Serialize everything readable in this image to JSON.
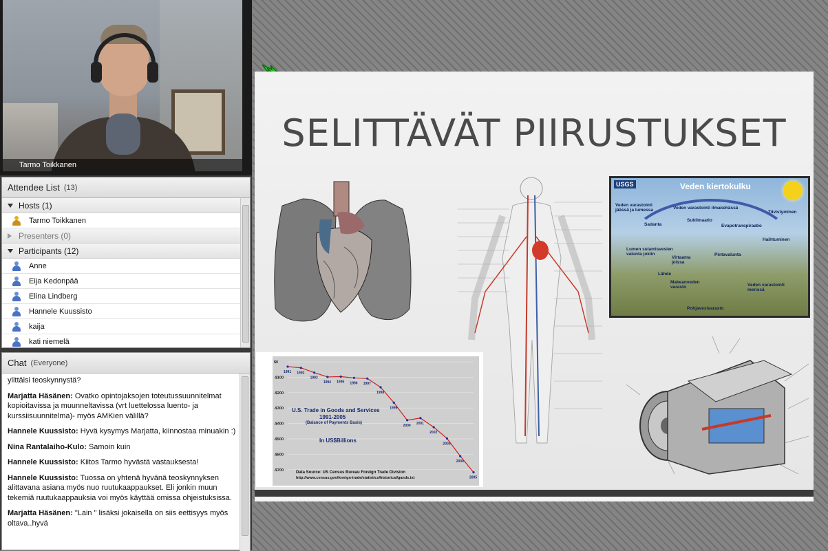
{
  "video": {
    "presenter_name": "Tarmo Toikkanen"
  },
  "attendee_list": {
    "title": "Attendee List",
    "count": "(13)",
    "groups": {
      "hosts": {
        "label": "Hosts (1)",
        "members": [
          "Tarmo Toikkanen"
        ]
      },
      "presenters": {
        "label": "Presenters (0)"
      },
      "participants": {
        "label": "Participants (12)",
        "members": [
          "Anne",
          "Eija Kedonpää",
          "Elina Lindberg",
          "Hannele Kuussisto",
          "kaija",
          "kati niemelä"
        ]
      }
    }
  },
  "chat": {
    "title": "Chat",
    "scope": "(Everyone)",
    "messages": [
      {
        "author": "",
        "text": "ylittäisi teoskynnystä?"
      },
      {
        "author": "Marjatta Häsänen:",
        "text": "Ovatko opintojaksojen toteutussuunnitelmat kopioitavissa ja muunneltavissa (vrt luettelossa luento- ja kurssiisuunnitelma)- myös AMKien välillä?"
      },
      {
        "author": "Hannele Kuussisto:",
        "text": "Hyvä kysymys Marjatta, kiinnostaa minuakin :)"
      },
      {
        "author": "Nina Rantalaiho-Kulo:",
        "text": "Samoin kuin"
      },
      {
        "author": "Hannele Kuussisto:",
        "text": "Kiitos Tarmo hyvästä vastauksesta!"
      },
      {
        "author": "Hannele Kuussisto:",
        "text": "Tuossa on yhtenä hyvänä teoskynnyksen alittavana asiana myös nuo ruutukaappaukset. Eli jonkin muun tekemiä ruutukaappauksia voi myös käyttää omissa ohjeistuksissa."
      },
      {
        "author": "Marjatta Häsänen:",
        "text": "\"Lain \" lisäksi jokaisella on siis eettisyys myös oltava..hyvä"
      }
    ]
  },
  "slide": {
    "title": "SELITTÄVÄT PIIRUSTUKSET",
    "water_cycle": {
      "title": "Veden kiertokulku",
      "logo": "USGS",
      "labels": [
        "Veden varastointi jäässä ja lumessa",
        "Veden varastointi ilmakehässä",
        "Tiivistyminen",
        "Sadanta",
        "Sublimaatio",
        "Evapotranspiraatio",
        "Haihtuminen",
        "Lumen sulamisvesien valunta jokiin",
        "Virtaama joissa",
        "Pintavalunta",
        "Lähde",
        "Makeanveden varasto",
        "Veden varastointi merissä",
        "Pohjavesivarasto"
      ]
    },
    "trade_chart": {
      "title": "U.S. Trade in Goods and Services",
      "subtitle": "1991-2005",
      "note": "(Balance of Payments Basis)",
      "unit": "In US$Billions",
      "source_label": "Data Source:  US Census Bureau Foreign Trade Division",
      "source_url": "http://www.census.gov/foreign-trade/statistics/historical/gands.txt"
    }
  },
  "chart_data": {
    "type": "line",
    "title": "U.S. Trade in Goods and Services",
    "subtitle": "1991-2005",
    "ylabel": "",
    "xlabel": "",
    "y_ticks": [
      "$0",
      "-$100",
      "-$200",
      "-$300",
      "-$400",
      "-$500",
      "-$600",
      "-$700"
    ],
    "ylim": [
      -750,
      0
    ],
    "x": [
      "1991",
      "1992",
      "1993",
      "1994",
      "1995",
      "1996",
      "1997",
      "1998",
      "1999",
      "2000",
      "2001",
      "2002",
      "2003",
      "2004",
      "2005"
    ],
    "values": [
      -31,
      -39,
      -70,
      -98,
      -96,
      -104,
      -108,
      -165,
      -265,
      -379,
      -365,
      -424,
      -497,
      -612,
      -717
    ],
    "grid": true
  },
  "colors": {
    "stage_bg": "#7a7a7a",
    "pod_header": "#e6e6e6",
    "chart_line": "#d02020",
    "chart_point": "#1a2fa0"
  }
}
